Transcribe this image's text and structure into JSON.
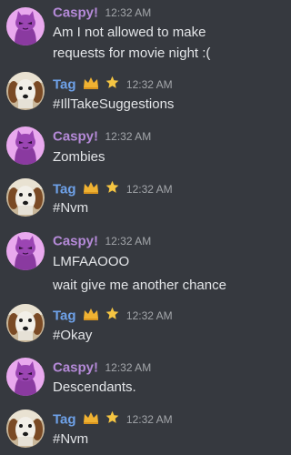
{
  "users": {
    "caspy": {
      "name": "Caspy!",
      "color": "#b58ad8",
      "avatar_icon": "purple-cat-avatar-icon"
    },
    "tag": {
      "name": "Tag",
      "color": "#6ea1e8",
      "badges": [
        "crown-icon",
        "star-icon"
      ],
      "avatar_icon": "dog-avatar-icon"
    }
  },
  "messages": [
    {
      "author": "Caspy!",
      "time": "12:32 AM",
      "lines": [
        "Am I not allowed to make",
        "requests for movie night :("
      ]
    },
    {
      "author": "Tag",
      "time": "12:32 AM",
      "lines": [
        "#IllTakeSuggestions"
      ]
    },
    {
      "author": "Caspy!",
      "time": "12:32 AM",
      "lines": [
        "Zombies"
      ]
    },
    {
      "author": "Tag",
      "time": "12:32 AM",
      "lines": [
        "#Nvm"
      ]
    },
    {
      "author": "Caspy!",
      "time": "12:32 AM",
      "lines": [
        "LMFAAOOO",
        "wait give me another chance"
      ]
    },
    {
      "author": "Tag",
      "time": "12:32 AM",
      "lines": [
        "#Okay"
      ]
    },
    {
      "author": "Caspy!",
      "time": "12:32 AM",
      "lines": [
        "Descendants."
      ]
    },
    {
      "author": "Tag",
      "time": "12:32 AM",
      "lines": [
        "#Nvm"
      ]
    }
  ],
  "theme": {
    "background": "#36393f",
    "text": "#e3e5e8",
    "timestamp": "#a3a6aa",
    "crown": "#f0b232",
    "star": "#f5c542"
  }
}
